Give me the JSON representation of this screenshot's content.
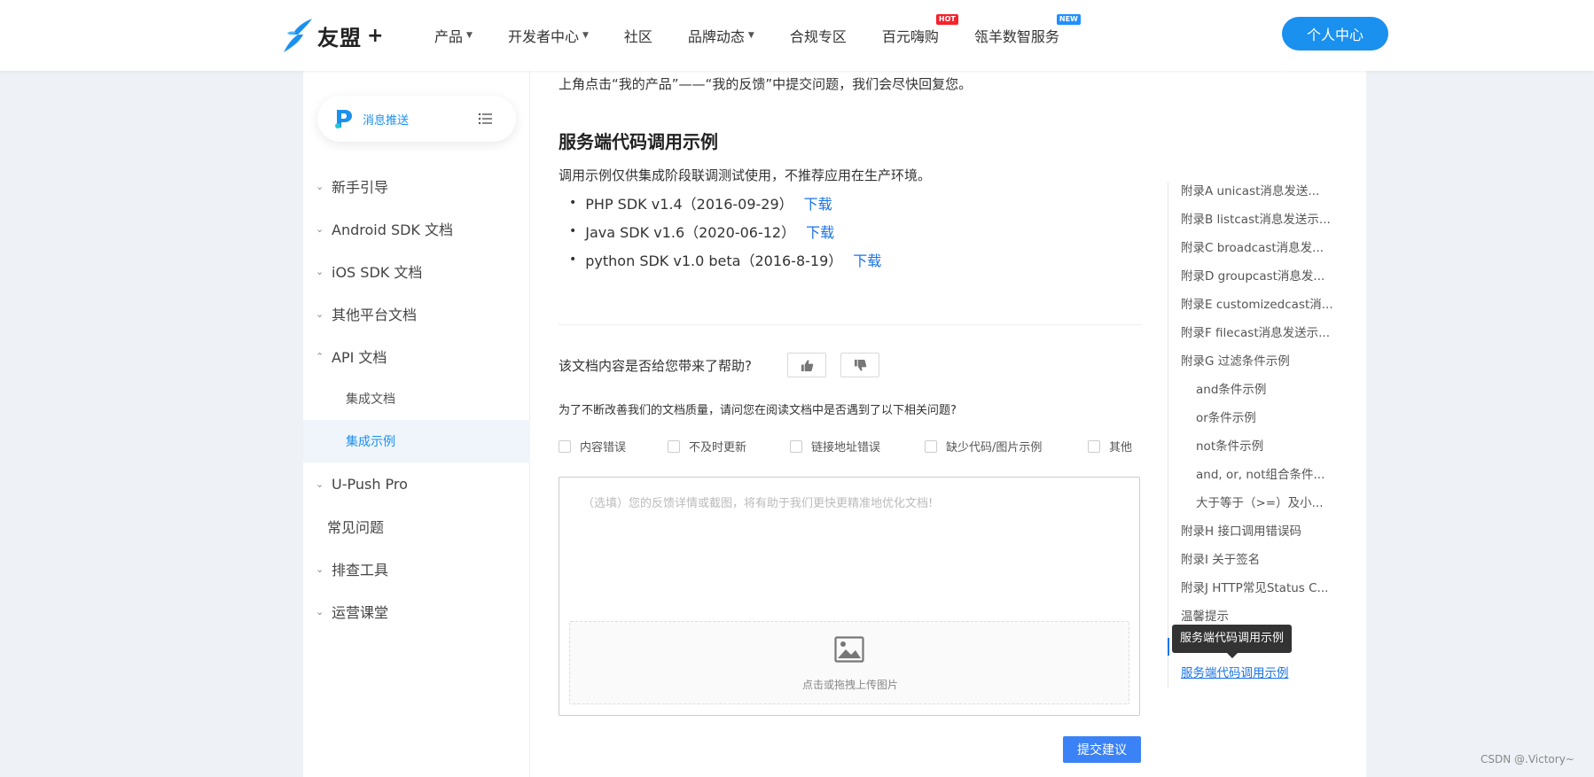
{
  "header": {
    "logo_text": "友盟",
    "logo_plus": "+",
    "nav": [
      {
        "label": "产品",
        "caret": true
      },
      {
        "label": "开发者中心",
        "caret": true
      },
      {
        "label": "社区"
      },
      {
        "label": "品牌动态",
        "caret": true
      },
      {
        "label": "合规专区"
      },
      {
        "label": "百元嗨购",
        "badge": "HOT"
      },
      {
        "label": "瓴羊数智服务",
        "badge": "NEW"
      }
    ],
    "personal_center": "个人中心"
  },
  "sidebar": {
    "product_name": "消息推送",
    "menu": [
      {
        "label": "新手引导",
        "arrow": "⌄"
      },
      {
        "label": "Android SDK 文档",
        "arrow": "⌄"
      },
      {
        "label": "iOS SDK 文档",
        "arrow": "⌄"
      },
      {
        "label": "其他平台文档",
        "arrow": "⌄"
      },
      {
        "label": "API 文档",
        "arrow": "⌃"
      },
      {
        "label": "集成文档"
      },
      {
        "label": "集成示例"
      },
      {
        "label": "U-Push Pro",
        "arrow": "⌄"
      },
      {
        "label": "常见问题"
      },
      {
        "label": "排查工具",
        "arrow": "⌄"
      },
      {
        "label": "运营课堂",
        "arrow": "⌄"
      }
    ]
  },
  "content": {
    "intro": "上角点击“我的产品”——“我的反馈”中提交问题，我们会尽快回复您。",
    "section_title": "服务端代码调用示例",
    "description": "调用示例仅供集成阶段联调测试使用，不推荐应用在生产环境。",
    "sdks": [
      {
        "name": "PHP SDK v1.4（2016-09-29）",
        "link": "下载"
      },
      {
        "name": "Java SDK v1.6（2020-06-12）",
        "link": "下载"
      },
      {
        "name": "python SDK v1.0 beta（2016-8-19）",
        "link": "下载"
      }
    ]
  },
  "feedback": {
    "helpful_question": "该文档内容是否给您带来了帮助?",
    "improve_question": "为了不断改善我们的文档质量，请问您在阅读文档中是否遇到了以下相关问题?",
    "options": [
      "内容错误",
      "不及时更新",
      "链接地址错误",
      "缺少代码/图片示例",
      "其他"
    ],
    "placeholder": "（选填）您的反馈详情或截图，将有助于我们更快更精准地优化文档!",
    "upload_label": "点击或拖拽上传图片",
    "submit": "提交建议"
  },
  "toc": {
    "items": [
      "附录A unicast消息发送...",
      "附录B listcast消息发送示...",
      "附录C broadcast消息发...",
      "附录D groupcast消息发...",
      "附录E customizedcast消...",
      "附录F filecast消息发送示...",
      "附录G 过滤条件示例",
      "and条件示例",
      "or条件示例",
      "not条件示例",
      "and, or, not组合条件...",
      "大于等于（>=）及小...",
      "附录H 接口调用错误码",
      "附录I 关于签名",
      "附录J HTTP常见Status C...",
      "温馨提示",
      "服务端代码调用示例"
    ],
    "tooltip": "服务端代码调用示例"
  },
  "watermark": "CSDN @.Victory~",
  "colors": {
    "accent": "#1a90ef",
    "link": "#1a73e8",
    "hot": "#f5222d",
    "new": "#1e90ff"
  }
}
